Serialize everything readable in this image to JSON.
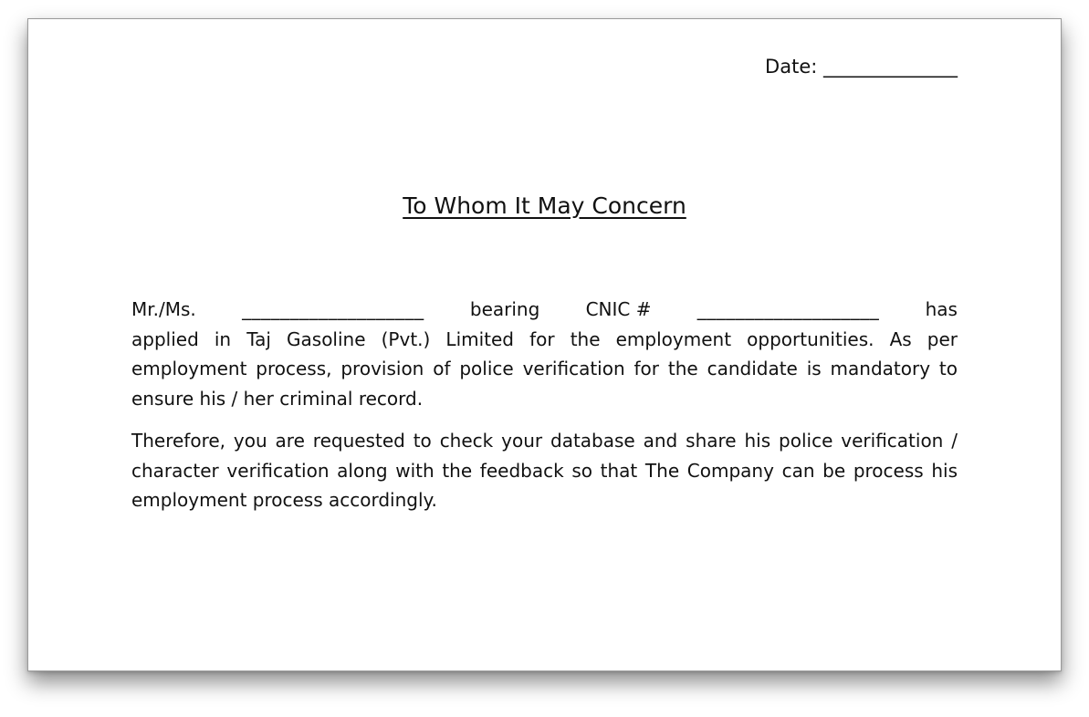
{
  "document": {
    "date_label": "Date: ______________",
    "title": "To Whom It May Concern",
    "paragraph1": {
      "line1": {
        "salutation": "Mr./Ms.",
        "name_blank": "___________________",
        "bearing": "bearing",
        "cnic_label": "CNIC #",
        "cnic_blank": "___________________",
        "has": "has"
      },
      "rest": "applied in Taj Gasoline (Pvt.) Limited for the employment opportunities. As per employment process, provision of police verification for the candidate is mandatory to ensure his / her criminal record."
    },
    "paragraph2": "Therefore, you are requested to check your database and share his police verification / character verification along with the feedback so that The Company can be process his employment process accordingly."
  }
}
